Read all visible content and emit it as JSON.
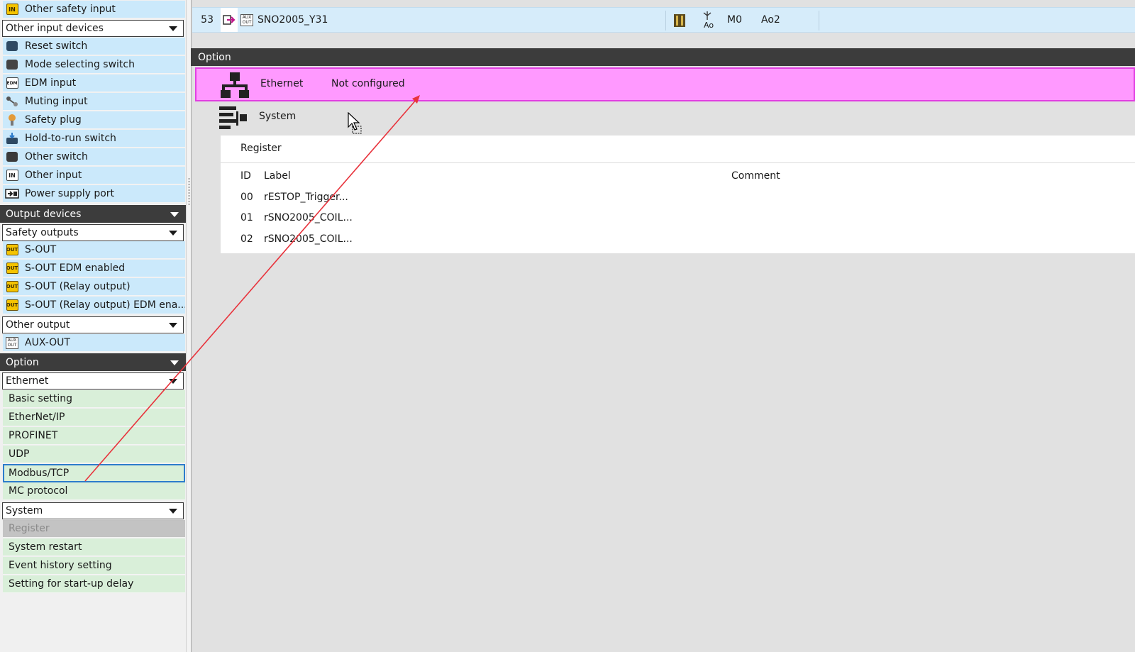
{
  "palette": {
    "top_items": [
      {
        "label": "Other safety input",
        "icon": "in-icon"
      }
    ],
    "input_devices_dropdown": "Other input devices",
    "input_items": [
      {
        "label": "Reset switch",
        "icon": "reset-switch-icon"
      },
      {
        "label": "Mode selecting switch",
        "icon": "mode-switch-icon"
      },
      {
        "label": "EDM input",
        "icon": "edm-icon"
      },
      {
        "label": "Muting input",
        "icon": "muting-icon"
      },
      {
        "label": "Safety plug",
        "icon": "safety-plug-icon"
      },
      {
        "label": "Hold-to-run switch",
        "icon": "hold-to-run-icon"
      },
      {
        "label": "Other switch",
        "icon": "other-switch-icon"
      },
      {
        "label": "Other input",
        "icon": "in-white-icon"
      },
      {
        "label": "Power supply port",
        "icon": "power-port-icon"
      }
    ],
    "output_header": "Output devices",
    "safety_outputs_dropdown": "Safety outputs",
    "safety_output_items": [
      {
        "label": "S-OUT",
        "icon": "out-icon"
      },
      {
        "label": "S-OUT EDM enabled",
        "icon": "out-icon"
      },
      {
        "label": "S-OUT (Relay output)",
        "icon": "out-icon"
      },
      {
        "label": "S-OUT (Relay output) EDM ena...",
        "icon": "out-icon"
      }
    ],
    "other_output_dropdown": "Other output",
    "other_output_items": [
      {
        "label": "AUX-OUT",
        "icon": "aux-out-icon"
      }
    ],
    "option_header": "Option",
    "ethernet_dropdown": "Ethernet",
    "ethernet_items": [
      {
        "label": "Basic setting"
      },
      {
        "label": "EtherNet/IP"
      },
      {
        "label": "PROFINET"
      },
      {
        "label": "UDP"
      },
      {
        "label": "Modbus/TCP",
        "selected": true
      },
      {
        "label": "MC protocol"
      }
    ],
    "system_dropdown": "System",
    "system_items": [
      {
        "label": "Register",
        "disabled": true
      },
      {
        "label": "System restart"
      },
      {
        "label": "Event history setting"
      },
      {
        "label": "Setting for start-up delay"
      }
    ]
  },
  "signal_row": {
    "number": "53",
    "tag": "SNO2005_Y31",
    "sub_label": "Ao",
    "col_m": "M0",
    "col_ao": "Ao2"
  },
  "option_panel": {
    "title": "Option",
    "ethernet": {
      "name": "Ethernet",
      "status": "Not configured"
    },
    "system": {
      "name": "System"
    }
  },
  "register": {
    "title": "Register",
    "headers": {
      "id": "ID",
      "label": "Label",
      "comment": "Comment"
    },
    "rows": [
      {
        "id": "00",
        "label": "rESTOP_Trigger..."
      },
      {
        "id": "01",
        "label": "rSNO2005_COIL..."
      },
      {
        "id": "02",
        "label": "rSNO2005_COIL..."
      }
    ]
  },
  "colors": {
    "header_dark": "#3c3c3c",
    "device_blue": "#cbe9fb",
    "option_green": "#d9efd9",
    "ethernet_highlight": "#ff99ff",
    "selection_border": "#2d7ccc",
    "annotation_arrow": "#e8333c"
  }
}
